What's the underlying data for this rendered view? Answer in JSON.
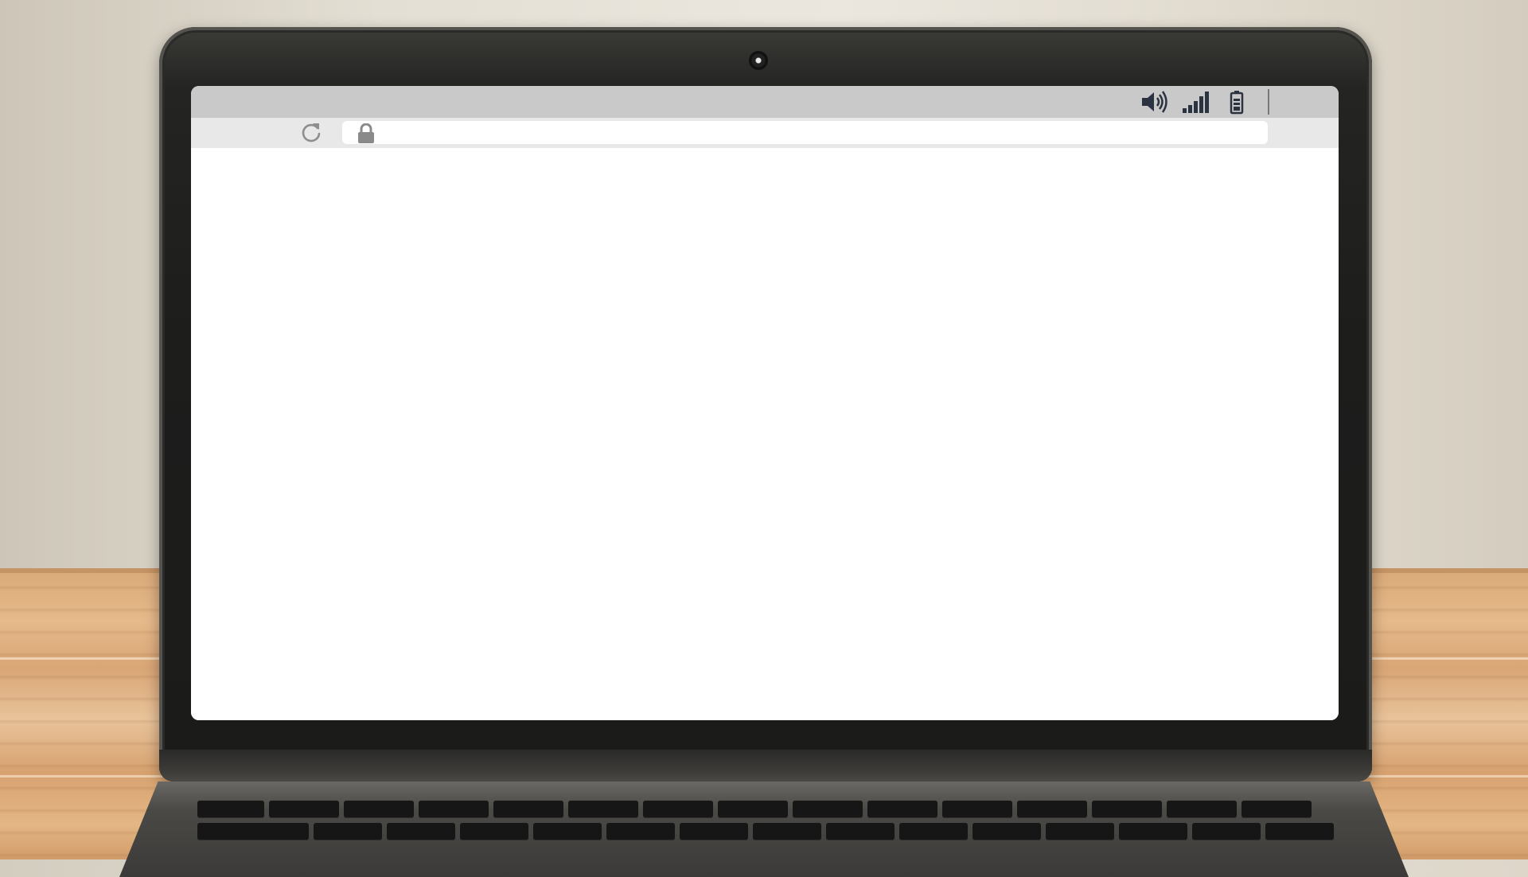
{
  "scene": {
    "device": "laptop",
    "colors": {
      "lid": "#1d1d1c",
      "screen_background": "#ffffff",
      "status_bar": "#c9c9c9",
      "toolbar": "#e8e8e8",
      "icon_dark": "#2b3240"
    }
  },
  "browser": {
    "status_bar": {
      "icons": [
        "speaker-icon",
        "signal-icon",
        "battery-icon"
      ]
    },
    "toolbar": {
      "reload_icon": "reload-icon",
      "lock_icon": "lock-icon",
      "url": ""
    },
    "content": {
      "state": "blank"
    }
  }
}
